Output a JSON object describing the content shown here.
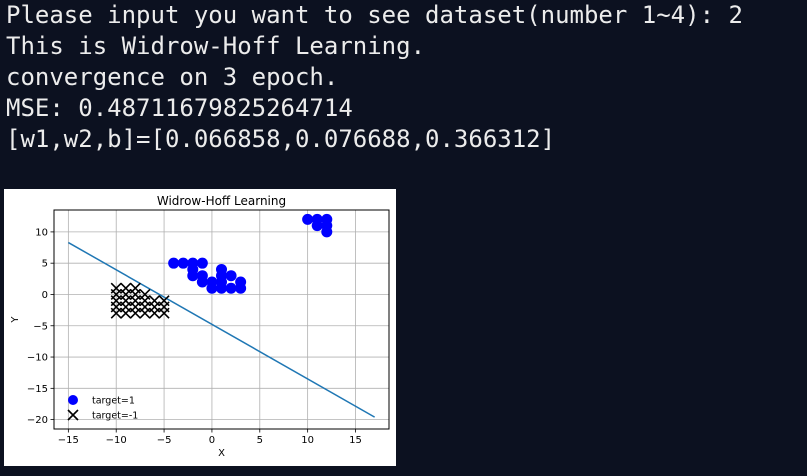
{
  "terminal": {
    "lines": [
      "Please input you want to see dataset(number 1~4): 2",
      "This is Widrow-Hoff Learning.",
      "convergence on 3 epoch.",
      "MSE: 0.48711679825264714",
      "[w1,w2,b]=[0.066858,0.076688,0.366312]"
    ]
  },
  "colors": {
    "background": "#0c1120",
    "text": "#ececec",
    "class_pos": "#0000ff",
    "class_neg": "#000000",
    "decision_line": "#1f77b4"
  },
  "chart_data": {
    "type": "scatter",
    "title": "Widrow-Hoff Learning",
    "xlabel": "X",
    "ylabel": "Y",
    "xlim": [
      -16.5,
      18.5
    ],
    "ylim": [
      -21.5,
      13.5
    ],
    "xticks": [
      -15,
      -10,
      -5,
      0,
      5,
      10,
      15
    ],
    "yticks": [
      10,
      5,
      0,
      -5,
      -10,
      -15,
      -20
    ],
    "grid": true,
    "legend_position": "lower-left",
    "series": [
      {
        "name": "target=1",
        "marker": "circle",
        "color": "#0000ff",
        "points": [
          [
            -4,
            5
          ],
          [
            -3,
            5
          ],
          [
            -2,
            5
          ],
          [
            -1,
            5
          ],
          [
            -2,
            4
          ],
          [
            -2,
            3
          ],
          [
            -1,
            3
          ],
          [
            -1,
            2
          ],
          [
            0,
            2
          ],
          [
            0,
            1
          ],
          [
            1,
            3
          ],
          [
            1,
            4
          ],
          [
            2,
            3
          ],
          [
            1,
            2
          ],
          [
            1,
            1
          ],
          [
            2,
            1
          ],
          [
            3,
            2
          ],
          [
            3,
            1
          ],
          [
            10,
            12
          ],
          [
            11,
            12
          ],
          [
            12,
            12
          ],
          [
            11,
            11
          ],
          [
            12,
            11
          ],
          [
            12,
            10
          ]
        ]
      },
      {
        "name": "target=-1",
        "marker": "x",
        "color": "#000000",
        "points": [
          [
            -10,
            1
          ],
          [
            -9,
            1
          ],
          [
            -8,
            1
          ],
          [
            -10,
            0
          ],
          [
            -9,
            0
          ],
          [
            -8,
            0
          ],
          [
            -7,
            0
          ],
          [
            -10,
            -1
          ],
          [
            -9,
            -1
          ],
          [
            -8,
            -1
          ],
          [
            -7,
            -1
          ],
          [
            -6,
            -1
          ],
          [
            -5,
            -1
          ],
          [
            -10,
            -2
          ],
          [
            -9,
            -2
          ],
          [
            -8,
            -2
          ],
          [
            -7,
            -2
          ],
          [
            -6,
            -2
          ],
          [
            -5,
            -2
          ],
          [
            -10,
            -3
          ],
          [
            -9,
            -3
          ],
          [
            -8,
            -3
          ],
          [
            -7,
            -3
          ],
          [
            -6,
            -3
          ],
          [
            -5,
            -3
          ]
        ]
      }
    ],
    "decision_boundary": {
      "color": "#1f77b4",
      "x": [
        -15,
        17
      ],
      "y": [
        8.3,
        -19.6
      ]
    }
  }
}
